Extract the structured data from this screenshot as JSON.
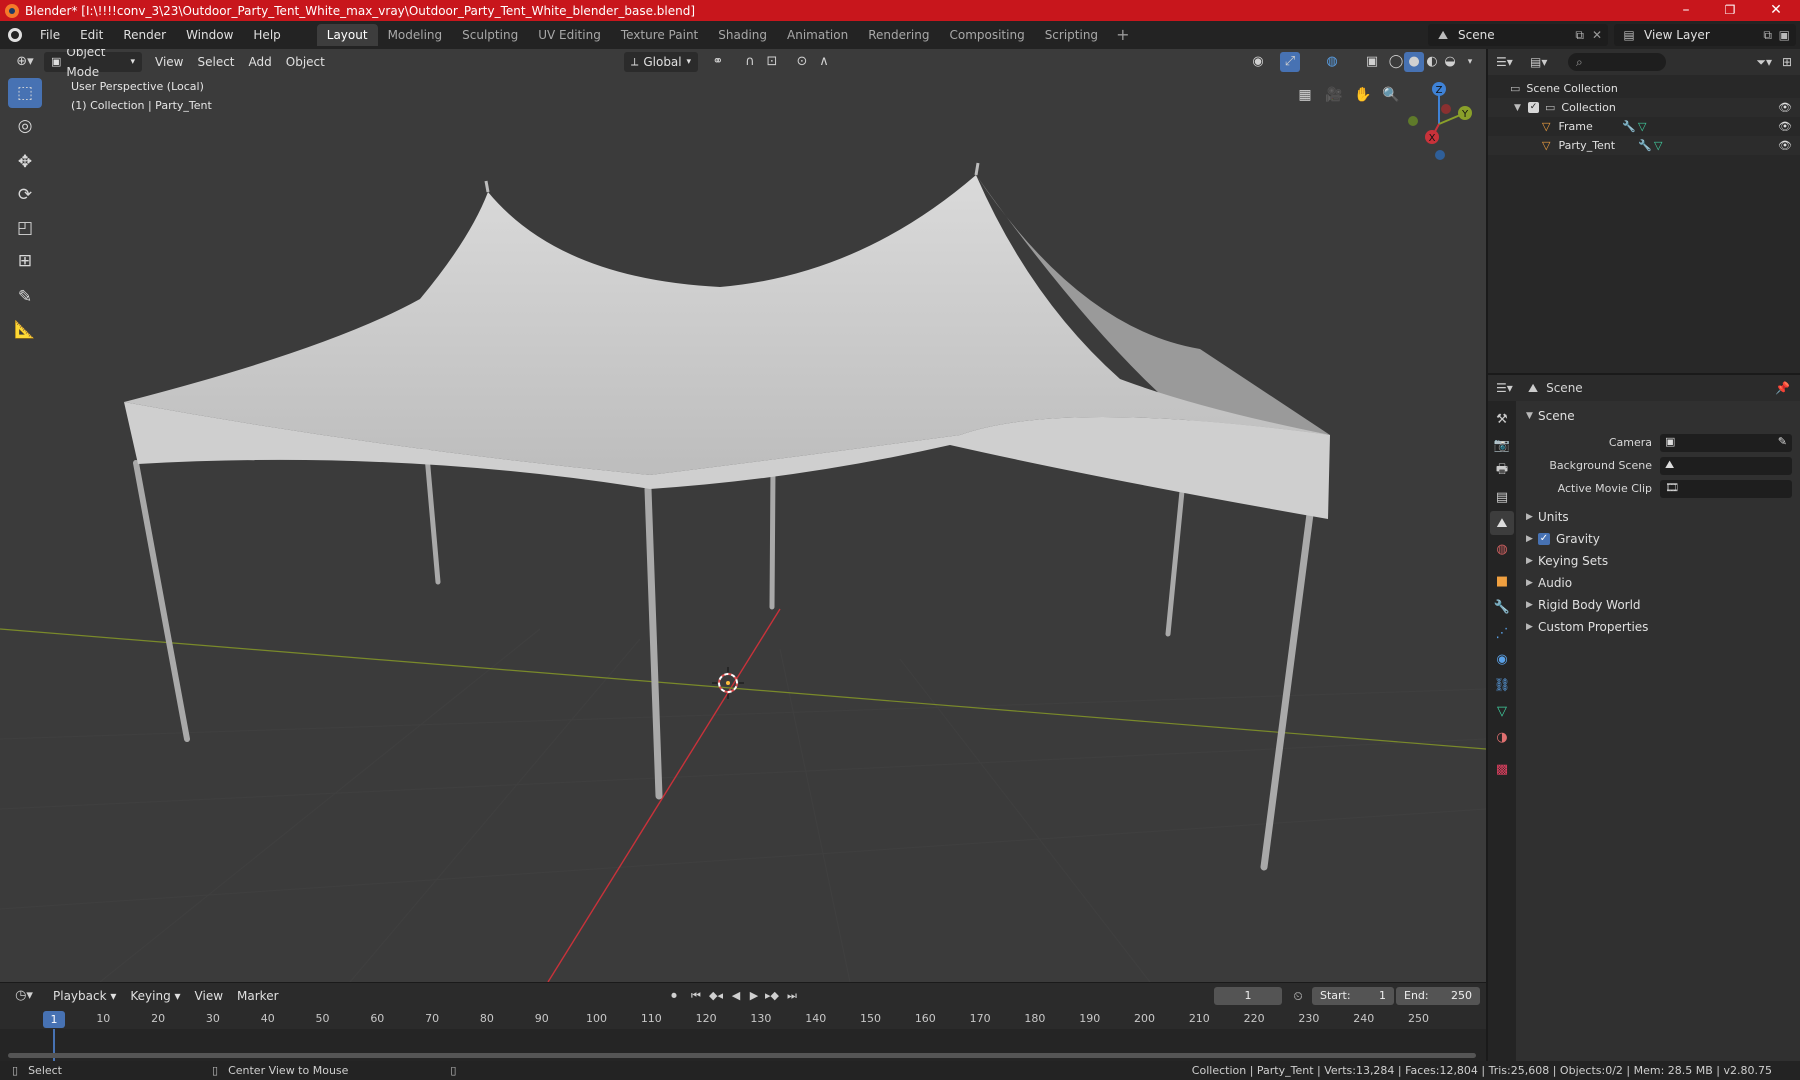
{
  "titlebar": {
    "title": "Blender* [I:\\!!!!conv_3\\23\\Outdoor_Party_Tent_White_max_vray\\Outdoor_Party_Tent_White_blender_base.blend]",
    "minimize": "–",
    "maximize": "❐",
    "close": "✕"
  },
  "menu": [
    "File",
    "Edit",
    "Render",
    "Window",
    "Help"
  ],
  "workspaces": [
    "Layout",
    "Modeling",
    "Sculpting",
    "UV Editing",
    "Texture Paint",
    "Shading",
    "Animation",
    "Rendering",
    "Compositing",
    "Scripting"
  ],
  "workspace_add": "+",
  "scene_selector": "Scene",
  "view_layer": "View Layer",
  "viewport": {
    "mode": "Object Mode",
    "menus": [
      "View",
      "Select",
      "Add",
      "Object"
    ],
    "transform_orientation": "Global",
    "info_line1": "User Perspective (Local)",
    "info_line2": "(1) Collection | Party_Tent",
    "gizmo": {
      "z": "Z",
      "y": "Y",
      "x": "X"
    },
    "colors": {
      "background": "#3b3b3b",
      "x_axis": "#c8323a",
      "y_axis": "#8aa02a",
      "z_axis": "#3f82d6",
      "tent": "#c9c9c9"
    }
  },
  "outliner": {
    "scene_collection": "Scene Collection",
    "items": [
      {
        "name": "Collection",
        "type": "collection"
      },
      {
        "name": "Frame",
        "type": "object"
      },
      {
        "name": "Party_Tent",
        "type": "object"
      }
    ]
  },
  "properties": {
    "context": "Scene",
    "panel": "Scene",
    "fields": [
      {
        "label": "Camera"
      },
      {
        "label": "Background Scene"
      },
      {
        "label": "Active Movie Clip"
      }
    ],
    "sections": [
      "Units",
      "Gravity",
      "Keying Sets",
      "Audio",
      "Rigid Body World",
      "Custom Properties"
    ],
    "gravity_checked": true
  },
  "timeline": {
    "menus": [
      "Playback",
      "Keying",
      "View",
      "Marker"
    ],
    "current_frame": "1",
    "start_label": "Start:",
    "start": "1",
    "end_label": "End:",
    "end": "250",
    "ticks": [
      "1",
      "10",
      "20",
      "30",
      "40",
      "50",
      "60",
      "70",
      "80",
      "90",
      "100",
      "110",
      "120",
      "130",
      "140",
      "150",
      "160",
      "170",
      "180",
      "190",
      "200",
      "210",
      "220",
      "230",
      "240",
      "250"
    ]
  },
  "statusbar": {
    "select": "Select",
    "center_view": "Center View to Mouse",
    "stats": "Collection | Party_Tent | Verts:13,284 | Faces:12,804 | Tris:25,608 | Objects:0/2 | Mem: 28.5 MB | v2.80.75"
  }
}
